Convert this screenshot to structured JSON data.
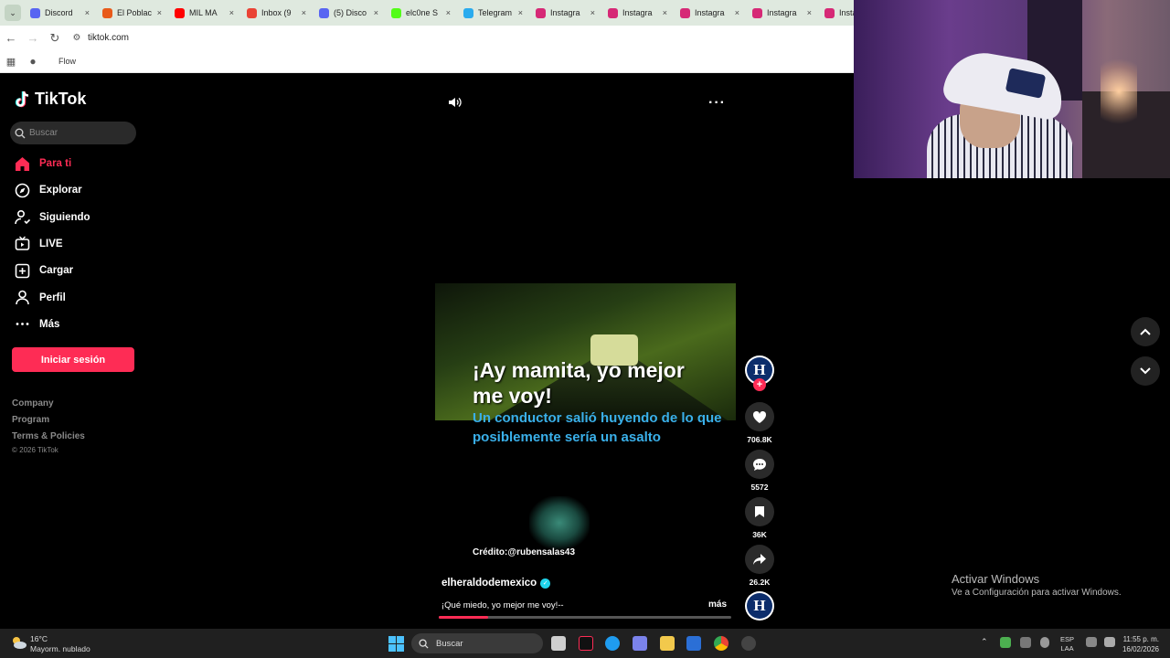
{
  "browser": {
    "tabs": [
      {
        "label": "Discord",
        "color": "#5865f2"
      },
      {
        "label": "El Poblac",
        "color": "#e85a1a"
      },
      {
        "label": "MIL MA",
        "color": "#ff0000"
      },
      {
        "label": "Inbox (9",
        "color": "#ea4335"
      },
      {
        "label": "(5) Disco",
        "color": "#5865f2"
      },
      {
        "label": "elc0ne S",
        "color": "#53fc18"
      },
      {
        "label": "Telegram",
        "color": "#2aabee"
      },
      {
        "label": "Instagra",
        "color": "#d62976"
      },
      {
        "label": "Instagra",
        "color": "#d62976"
      },
      {
        "label": "Instagra",
        "color": "#d62976"
      },
      {
        "label": "Instagra",
        "color": "#d62976"
      },
      {
        "label": "Insta",
        "color": "#d62976"
      }
    ],
    "tab_close": "×",
    "url": "tiktok.com",
    "bookmark": "Flow"
  },
  "tiktok": {
    "brand": "TikTok",
    "search_placeholder": "Buscar",
    "nav": [
      {
        "label": "Para ti",
        "icon": "home-icon",
        "active": true
      },
      {
        "label": "Explorar",
        "icon": "compass-icon"
      },
      {
        "label": "Siguiendo",
        "icon": "following-icon"
      },
      {
        "label": "LIVE",
        "icon": "live-icon"
      },
      {
        "label": "Cargar",
        "icon": "upload-icon"
      },
      {
        "label": "Perfil",
        "icon": "profile-icon"
      },
      {
        "label": "Más",
        "icon": "more-icon"
      }
    ],
    "login_button": "Iniciar sesión",
    "footer": [
      "Company",
      "Program",
      "Terms & Policies"
    ],
    "copyright": "© 2026 TikTok",
    "accent": "#fe2c55"
  },
  "video": {
    "overlay_title": "¡Ay mamita, yo mejor me voy!",
    "overlay_subtitle": "Un conductor salió huyendo de lo que posiblemente sería un asalto",
    "credit": "Crédito:@rubensalas43",
    "author": "elheraldodemexico",
    "caption": "¡Qué miedo, yo mejor me voy!--",
    "more_link": "más",
    "avatar_letter": "H",
    "likes": "706.8K",
    "comments": "5572",
    "saves": "36K",
    "shares": "26.2K",
    "progress": 0.17
  },
  "windows": {
    "activate_title": "Activar Windows",
    "activate_sub": "Ve a Configuración para activar Windows.",
    "weather_temp": "16°C",
    "weather_desc": "Mayorm. nublado",
    "search": "Buscar",
    "lang": "ESP",
    "lang2": "LAA",
    "time": "11:55 p. m.",
    "date": "16/02/2026"
  }
}
